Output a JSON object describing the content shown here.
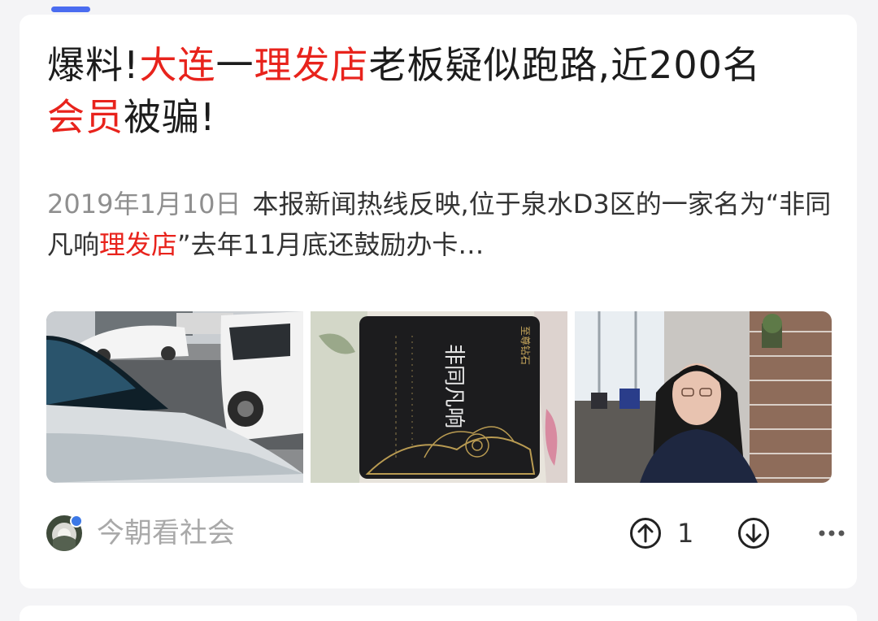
{
  "feed": {
    "article": {
      "title_parts": {
        "p1": "爆料!",
        "p2": "大连",
        "p3": "一",
        "p4": "理发店",
        "p5": "老板疑似跑路,近200名",
        "p6": "会员",
        "p7": "被骗!"
      },
      "date": "2019年1月10日",
      "summary_parts": {
        "s1": "本报新闻热线反映,位于泉水D3区的一家名为“非同凡响",
        "s2": "理发店",
        "s3": "”去年11月底还鼓励办卡…"
      },
      "images": [
        {
          "name": "street-cars-photo"
        },
        {
          "name": "member-card-photo",
          "card_text": "非同凡响",
          "card_corner": "至尊钻石"
        },
        {
          "name": "woman-in-shop-photo"
        }
      ],
      "author": "今朝看社会",
      "upvote_count": "1",
      "icons": {
        "avatar": "avatar",
        "upvote": "arrow-up-circle-icon",
        "downvote": "arrow-down-circle-icon",
        "more": "more-dots-icon"
      },
      "colors": {
        "highlight": "#e8231c",
        "tab_indicator": "#4a6cf0",
        "date": "#8f8f8f",
        "author": "#a9a9a9"
      }
    }
  }
}
